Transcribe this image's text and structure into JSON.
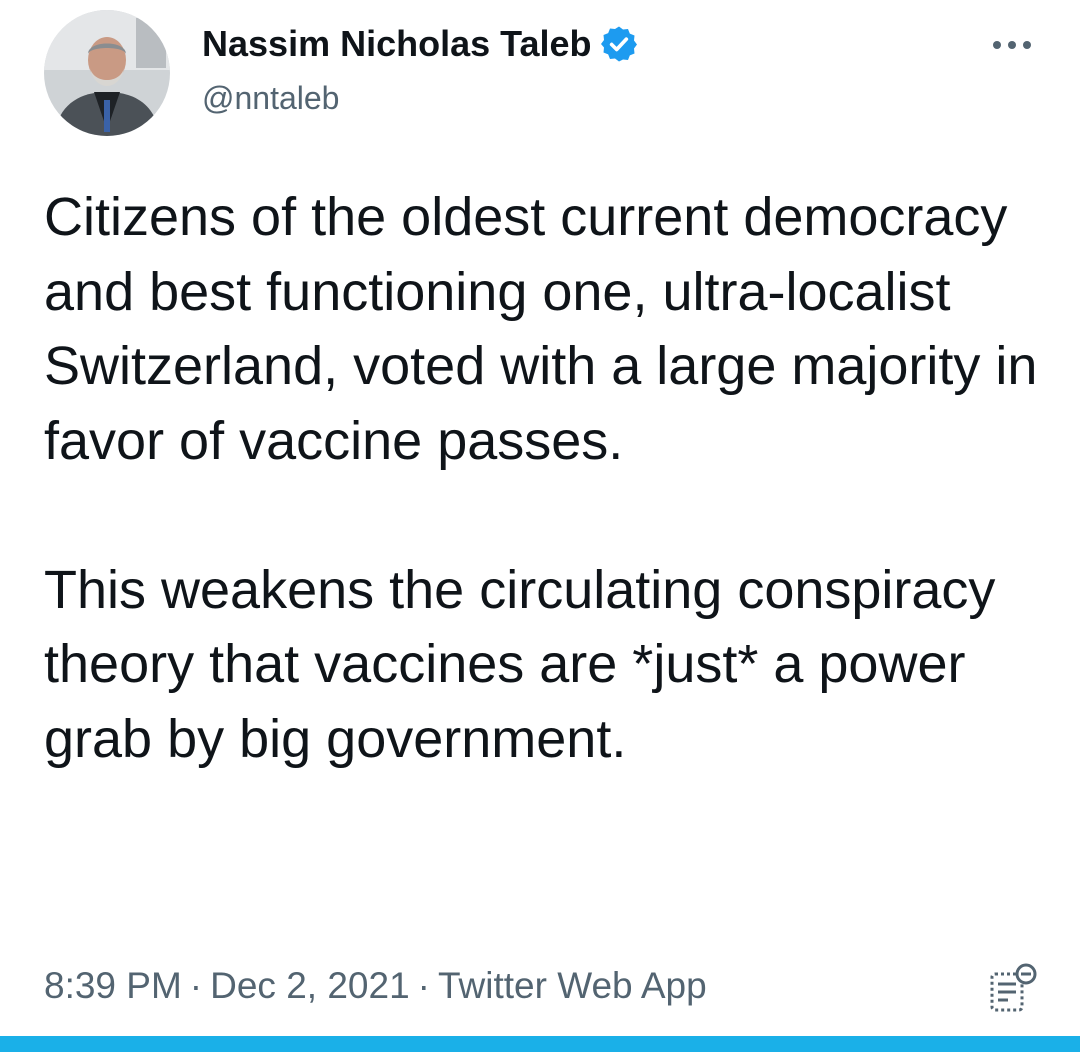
{
  "author": {
    "display_name": "Nassim Nicholas Taleb",
    "handle": "@nntaleb",
    "avatar_icon": "profile-photo",
    "verified_icon": "verified-badge-icon"
  },
  "tweet": {
    "paragraphs": [
      "Citizens of the oldest current democracy and best functioning one, ultra-localist Switzerland, voted with a large majority in favor of vaccine passes.",
      "This weakens the circulating conspiracy theory that vaccines are *just* a power grab by big government."
    ]
  },
  "meta": {
    "time": "8:39 PM",
    "separator": "·",
    "date": "Dec 2, 2021",
    "source": "Twitter Web App"
  },
  "icons": {
    "more": "more-options-icon",
    "analytics": "tweet-analytics-icon"
  },
  "colors": {
    "text_primary": "#0f1419",
    "text_secondary": "#536471",
    "verified_blue": "#1d9bf0",
    "bottom_bar": "#1ab0e8"
  }
}
